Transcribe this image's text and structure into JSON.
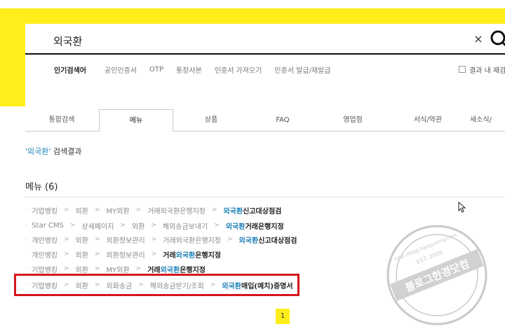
{
  "search": {
    "query": "외국환",
    "clear_glyph": "×",
    "search_icon": "search-icon"
  },
  "popular": {
    "title": "인기검색어",
    "keywords": [
      "공인인증서",
      "OTP",
      "통장사본",
      "인증서 가져오기",
      "인증서 발급/재발급"
    ],
    "in_result_label": "결과 내 재검"
  },
  "tabs": [
    {
      "label": "통합검색"
    },
    {
      "label": "메뉴"
    },
    {
      "label": "상품"
    },
    {
      "label": "FAQ"
    },
    {
      "label": "영업점"
    },
    {
      "label": "서식/약관"
    },
    {
      "label": "새소식/"
    }
  ],
  "active_tab": "메뉴",
  "result_summary": {
    "open_quote": "'",
    "keyword": "외국환",
    "close_quote": "'",
    "suffix": " 검색결과"
  },
  "menu_section": {
    "title": "메뉴 (6)"
  },
  "results": [
    {
      "crumbs": [
        "기업뱅킹",
        "외환",
        "MY외환",
        "거래외국환은행지정"
      ],
      "target_prefix": "",
      "target_hl": "외국환",
      "target_suffix": "신고대상점검"
    },
    {
      "crumbs": [
        "Star CMS",
        "상세페이지",
        "외환",
        "해외송금보내기"
      ],
      "target_prefix": "",
      "target_hl": "외국환",
      "target_suffix": "거래은행지정"
    },
    {
      "crumbs": [
        "개인뱅킹",
        "외환",
        "외환정보관리",
        "거래외국환은행지정"
      ],
      "target_prefix": "",
      "target_hl": "외국환",
      "target_suffix": "신고대상점검"
    },
    {
      "crumbs": [
        "개인뱅킹",
        "외환",
        "외환정보관리"
      ],
      "target_prefix": "거래",
      "target_hl": "외국환",
      "target_suffix": "은행지정"
    },
    {
      "crumbs": [
        "기업뱅킹",
        "외환",
        "MY외환"
      ],
      "target_prefix": "거래",
      "target_hl": "외국환",
      "target_suffix": "은행지정"
    },
    {
      "crumbs": [
        "기업뱅킹",
        "외환",
        "외화송금",
        "해외송금받기/조회"
      ],
      "target_prefix": "",
      "target_hl": "외국환",
      "target_suffix": "매입(예치)증명서"
    }
  ],
  "separator_glyph": ">",
  "bullet_glyph": "·",
  "pagination": {
    "current": "1"
  },
  "watermark": {
    "site": "http://blog.hangyeong.com",
    "name": "블로그한경닷컴",
    "est": "EST. 2009"
  },
  "colors": {
    "brand_yellow": "#ffee1a",
    "highlight_blue": "#1b7fb8",
    "annotation_red": "#d4161c"
  }
}
